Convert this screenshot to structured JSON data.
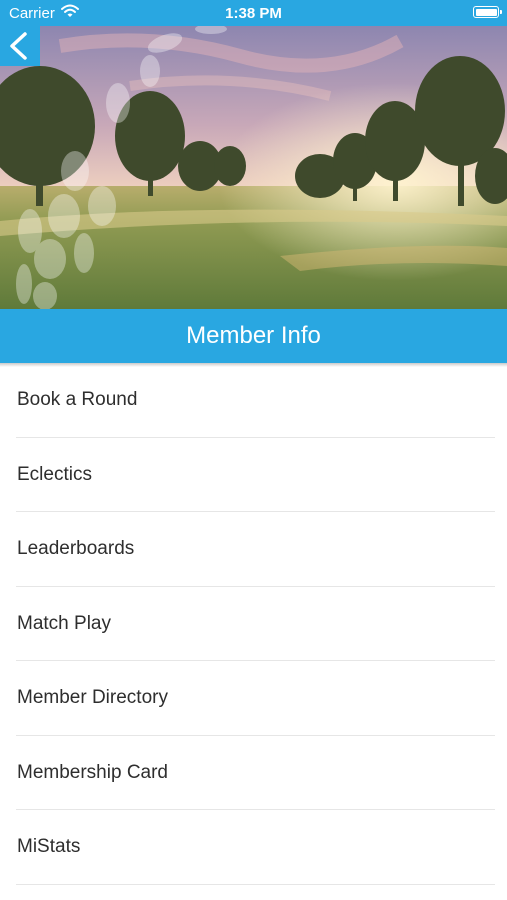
{
  "status_bar": {
    "carrier": "Carrier",
    "time": "1:38 PM",
    "wifi_icon": "wifi-icon",
    "battery_icon": "battery-icon"
  },
  "colors": {
    "accent": "#29a7e1",
    "text": "#2e2e2e",
    "divider": "#e6e6e6"
  },
  "header": {
    "back_icon": "chevron-left-icon",
    "title": "Member Info"
  },
  "menu": {
    "items": [
      {
        "label": "Book a Round"
      },
      {
        "label": "Eclectics"
      },
      {
        "label": "Leaderboards"
      },
      {
        "label": "Match Play"
      },
      {
        "label": "Member Directory"
      },
      {
        "label": "Membership Card"
      },
      {
        "label": "MiStats"
      }
    ]
  }
}
